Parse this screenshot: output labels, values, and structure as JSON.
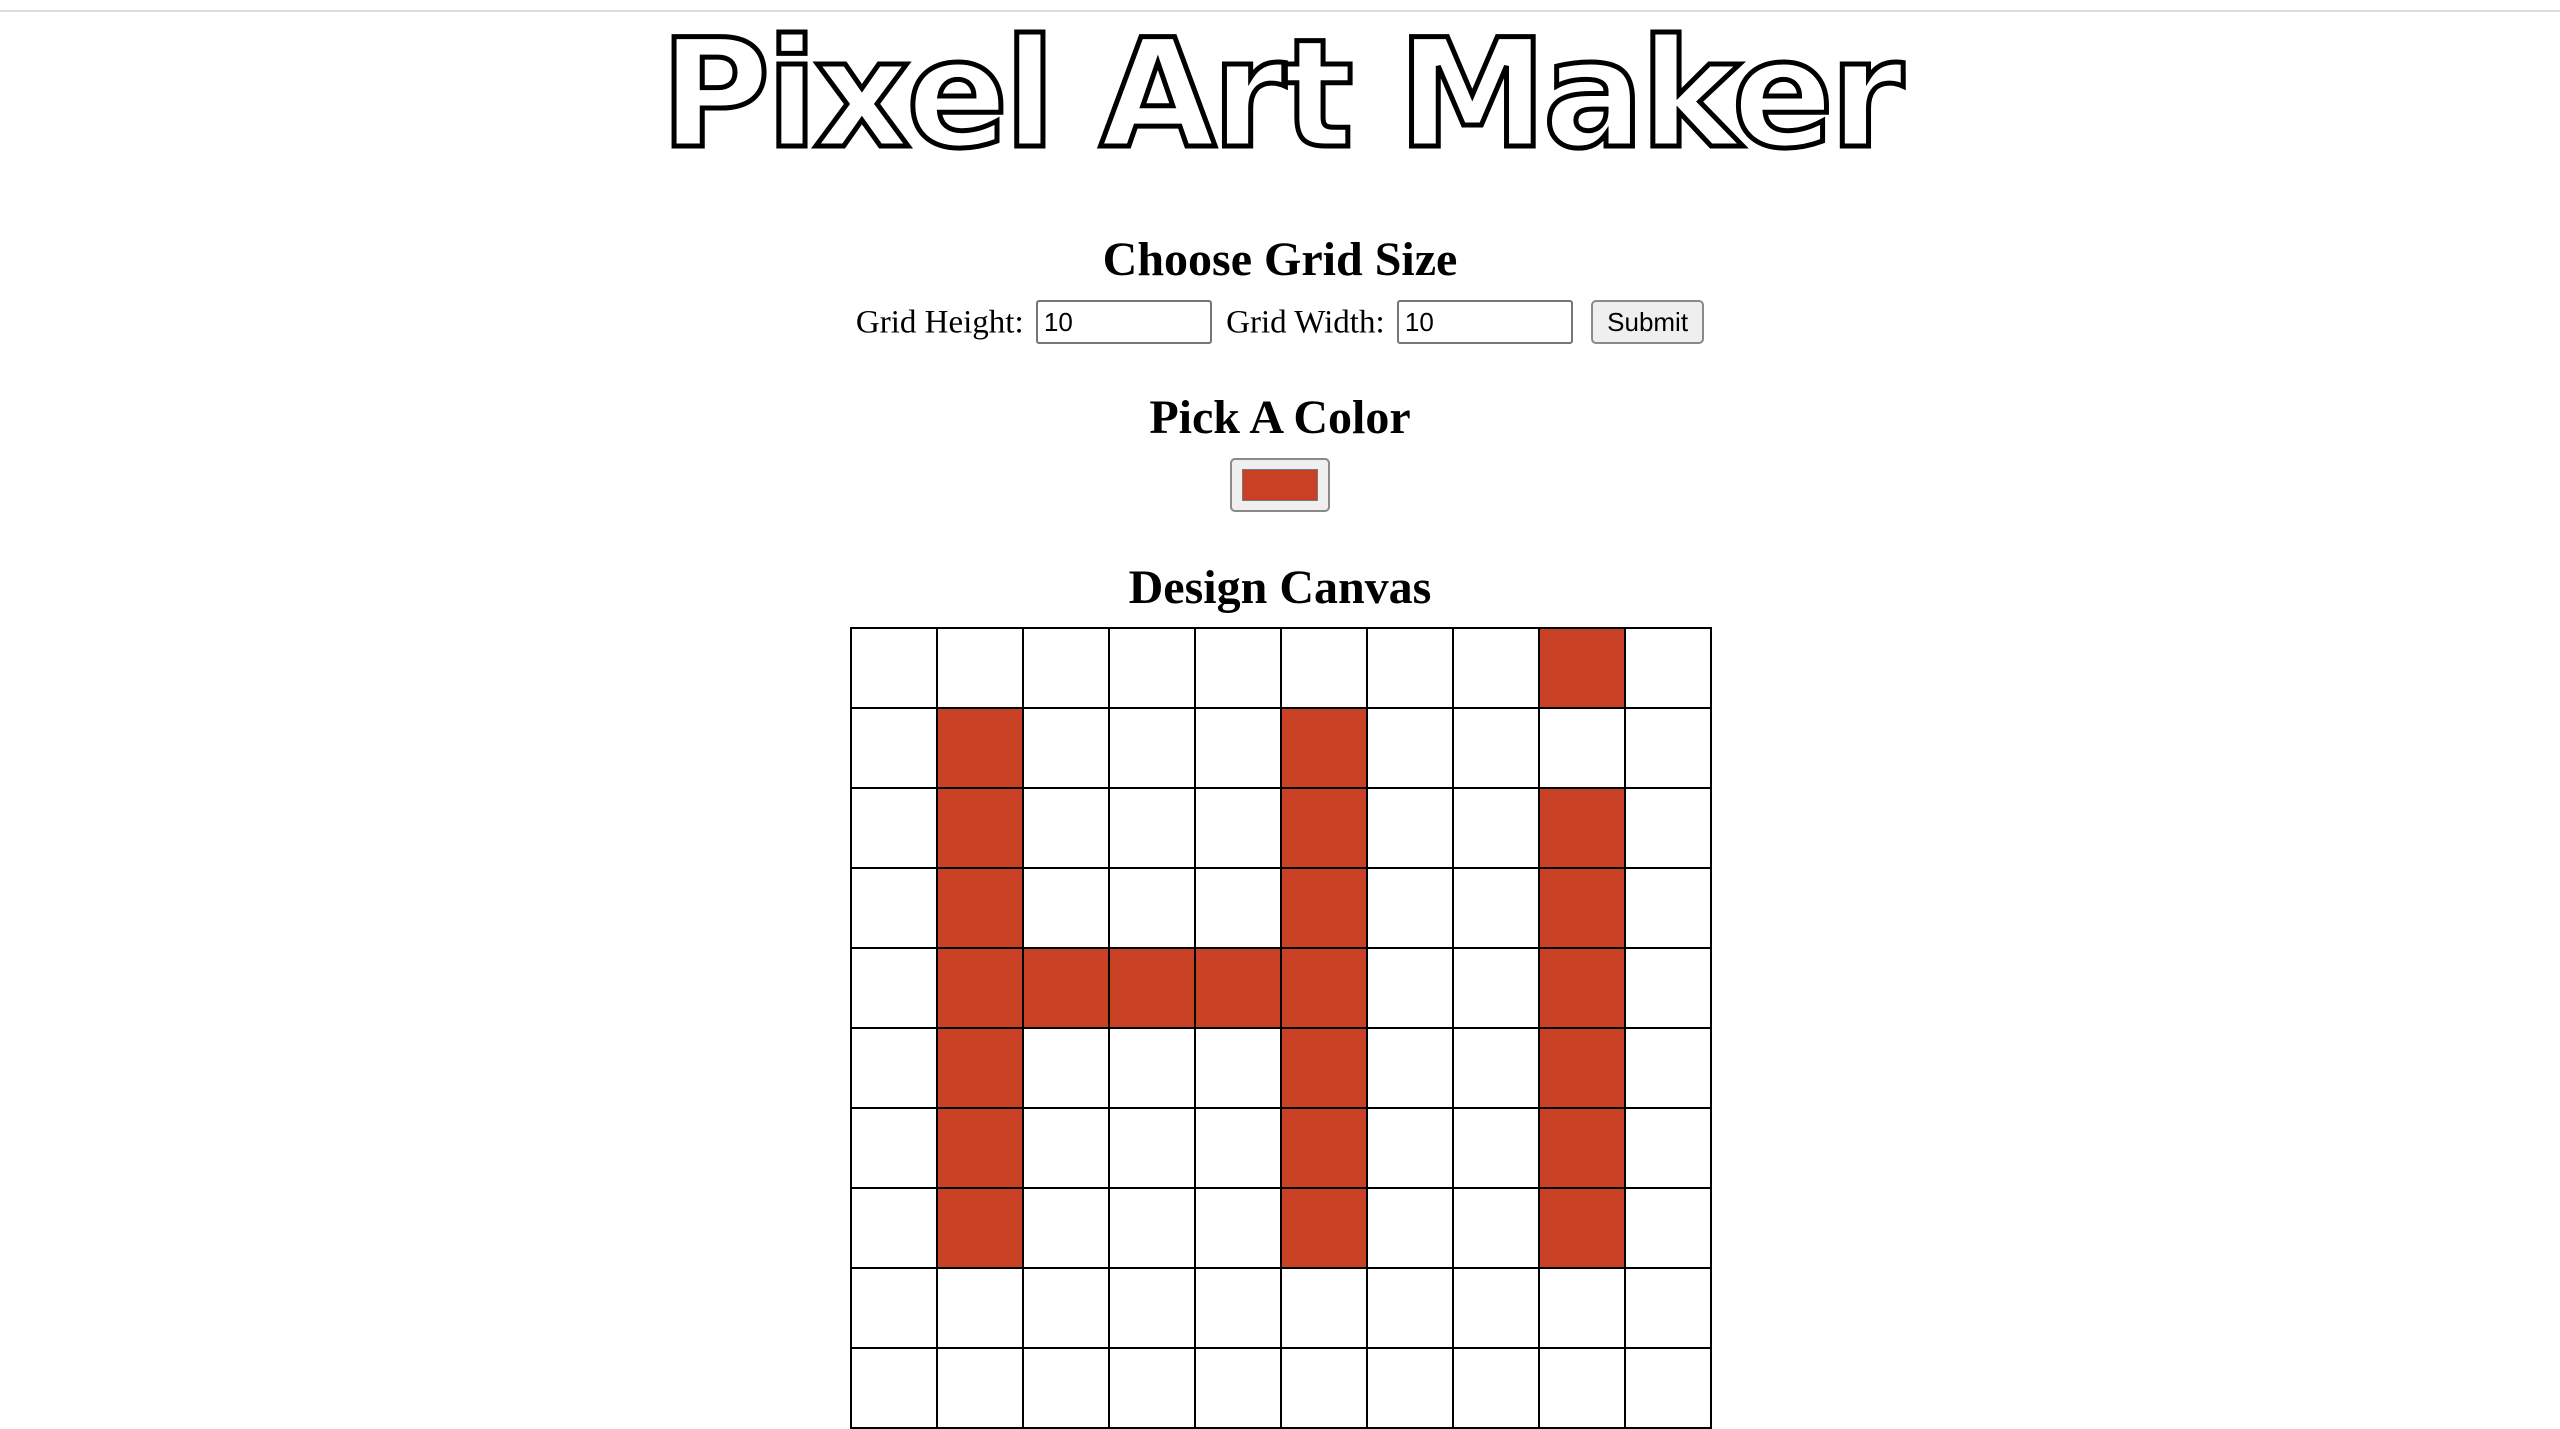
{
  "header": {
    "title": "Pixel Art Maker"
  },
  "grid_size": {
    "heading": "Choose Grid Size",
    "height_label": "Grid Height:",
    "height_value": "10",
    "width_label": "Grid Width:",
    "width_value": "10",
    "submit_label": "Submit"
  },
  "color": {
    "heading": "Pick A Color",
    "selected": "#c94124"
  },
  "canvas": {
    "heading": "Design Canvas",
    "fill_color": "#c94124",
    "rows": [
      [
        0,
        0,
        0,
        0,
        0,
        0,
        0,
        0,
        1,
        0
      ],
      [
        0,
        1,
        0,
        0,
        0,
        1,
        0,
        0,
        0,
        0
      ],
      [
        0,
        1,
        0,
        0,
        0,
        1,
        0,
        0,
        1,
        0
      ],
      [
        0,
        1,
        0,
        0,
        0,
        1,
        0,
        0,
        1,
        0
      ],
      [
        0,
        1,
        1,
        1,
        1,
        1,
        0,
        0,
        1,
        0
      ],
      [
        0,
        1,
        0,
        0,
        0,
        1,
        0,
        0,
        1,
        0
      ],
      [
        0,
        1,
        0,
        0,
        0,
        1,
        0,
        0,
        1,
        0
      ],
      [
        0,
        1,
        0,
        0,
        0,
        1,
        0,
        0,
        1,
        0
      ],
      [
        0,
        0,
        0,
        0,
        0,
        0,
        0,
        0,
        0,
        0
      ],
      [
        0,
        0,
        0,
        0,
        0,
        0,
        0,
        0,
        0,
        0
      ]
    ]
  }
}
